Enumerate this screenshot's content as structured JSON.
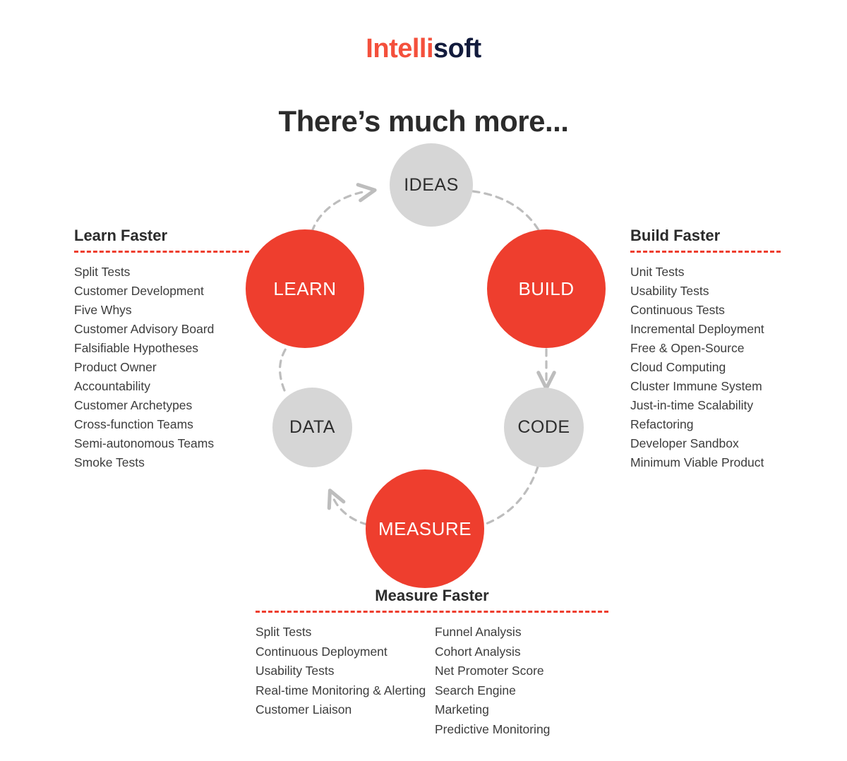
{
  "logo": {
    "part1": "Intelli",
    "part2": "soft",
    "color1": "#F4503C",
    "color2": "#121B3C"
  },
  "headline": "There’s much more...",
  "accent_color": "#EE3E2E",
  "gray_circle_color": "#D6D6D6",
  "diagram": {
    "nodes": [
      {
        "label": "IDEAS",
        "style": "gray"
      },
      {
        "label": "BUILD",
        "style": "red"
      },
      {
        "label": "CODE",
        "style": "gray"
      },
      {
        "label": "MEASURE",
        "style": "red"
      },
      {
        "label": "DATA",
        "style": "gray"
      },
      {
        "label": "LEARN",
        "style": "red"
      }
    ]
  },
  "panels": {
    "learn": {
      "title": "Learn Faster",
      "items": [
        "Split Tests",
        "Customer Development",
        "Five Whys",
        "Customer Advisory Board",
        "Falsifiable Hypotheses",
        "Product Owner",
        "Accountability",
        "Customer Archetypes",
        "Cross-function Teams",
        "Semi-autonomous Teams",
        "Smoke Tests"
      ]
    },
    "build": {
      "title": "Build Faster",
      "items": [
        "Unit Tests",
        "Usability Tests",
        "Continuous Tests",
        "Incremental Deployment",
        "Free & Open-Source",
        "Cloud Computing",
        "Cluster Immune System",
        "Just-in-time Scalability",
        "Refactoring",
        "Developer Sandbox",
        "Minimum Viable Product"
      ]
    },
    "measure": {
      "title": "Measure Faster",
      "items_left": [
        "Split Tests",
        "Continuous Deployment",
        "Usability Tests",
        "Real-time Monitoring & Alerting",
        "Customer Liaison"
      ],
      "items_right": [
        "Funnel Analysis",
        "Cohort Analysis",
        "Net Promoter Score",
        "Search Engine",
        "Marketing",
        "Predictive Monitoring"
      ]
    }
  }
}
